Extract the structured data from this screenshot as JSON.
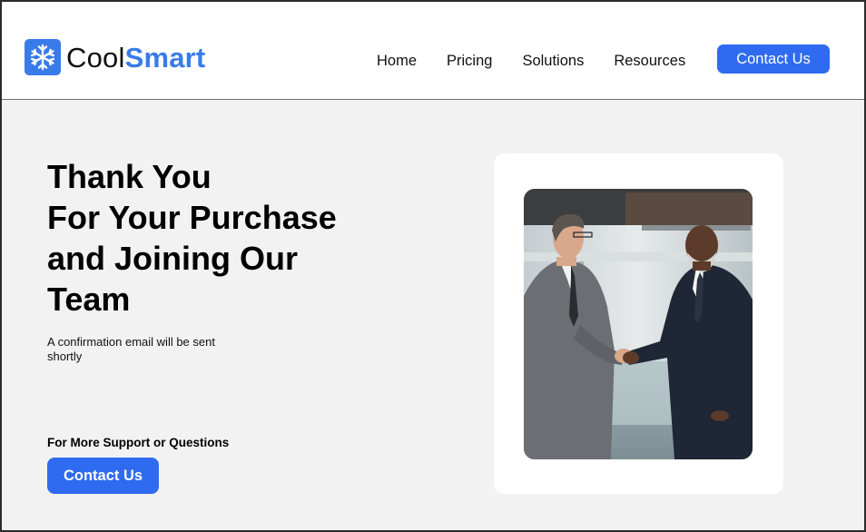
{
  "brand": {
    "name_part1": "Cool",
    "name_part2": "Smart",
    "logo_icon": "snowflake-icon",
    "accent_color": "#3a7bea"
  },
  "nav": {
    "items": [
      {
        "label": "Home"
      },
      {
        "label": "Pricing"
      },
      {
        "label": "Solutions"
      },
      {
        "label": "Resources"
      }
    ],
    "cta_label": "Contact Us"
  },
  "hero": {
    "headline_lines": [
      "Thank You",
      "For Your Purchase",
      "and Joining Our",
      "Team"
    ],
    "confirmation": "A confirmation email will be sent shortly",
    "support_label": "For More Support or Questions",
    "cta_label": "Contact Us",
    "photo": "handshake-photo"
  },
  "colors": {
    "button": "#2f6bf0",
    "page_bg": "#f2f2f2",
    "header_bg": "#ffffff"
  }
}
